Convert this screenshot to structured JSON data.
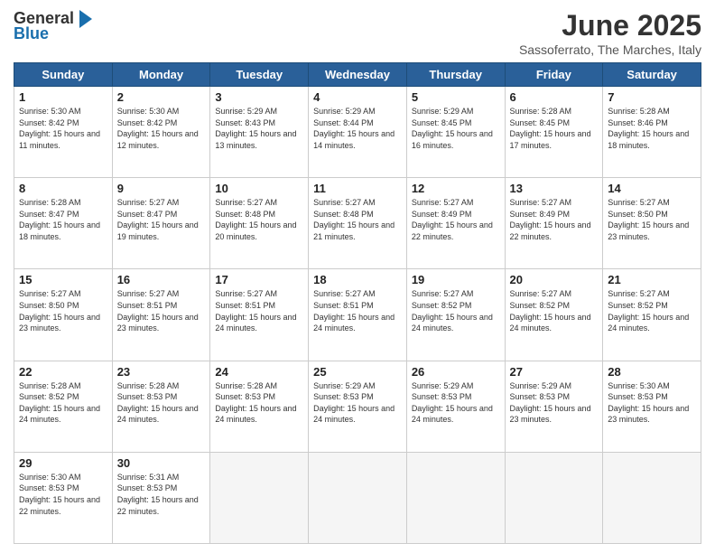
{
  "header": {
    "logo_general": "General",
    "logo_blue": "Blue",
    "month_title": "June 2025",
    "location": "Sassoferrato, The Marches, Italy"
  },
  "days_of_week": [
    "Sunday",
    "Monday",
    "Tuesday",
    "Wednesday",
    "Thursday",
    "Friday",
    "Saturday"
  ],
  "weeks": [
    [
      {
        "day": "1",
        "sunrise": "Sunrise: 5:30 AM",
        "sunset": "Sunset: 8:42 PM",
        "daylight": "Daylight: 15 hours and 11 minutes."
      },
      {
        "day": "2",
        "sunrise": "Sunrise: 5:30 AM",
        "sunset": "Sunset: 8:42 PM",
        "daylight": "Daylight: 15 hours and 12 minutes."
      },
      {
        "day": "3",
        "sunrise": "Sunrise: 5:29 AM",
        "sunset": "Sunset: 8:43 PM",
        "daylight": "Daylight: 15 hours and 13 minutes."
      },
      {
        "day": "4",
        "sunrise": "Sunrise: 5:29 AM",
        "sunset": "Sunset: 8:44 PM",
        "daylight": "Daylight: 15 hours and 14 minutes."
      },
      {
        "day": "5",
        "sunrise": "Sunrise: 5:29 AM",
        "sunset": "Sunset: 8:45 PM",
        "daylight": "Daylight: 15 hours and 16 minutes."
      },
      {
        "day": "6",
        "sunrise": "Sunrise: 5:28 AM",
        "sunset": "Sunset: 8:45 PM",
        "daylight": "Daylight: 15 hours and 17 minutes."
      },
      {
        "day": "7",
        "sunrise": "Sunrise: 5:28 AM",
        "sunset": "Sunset: 8:46 PM",
        "daylight": "Daylight: 15 hours and 18 minutes."
      }
    ],
    [
      {
        "day": "8",
        "sunrise": "Sunrise: 5:28 AM",
        "sunset": "Sunset: 8:47 PM",
        "daylight": "Daylight: 15 hours and 18 minutes."
      },
      {
        "day": "9",
        "sunrise": "Sunrise: 5:27 AM",
        "sunset": "Sunset: 8:47 PM",
        "daylight": "Daylight: 15 hours and 19 minutes."
      },
      {
        "day": "10",
        "sunrise": "Sunrise: 5:27 AM",
        "sunset": "Sunset: 8:48 PM",
        "daylight": "Daylight: 15 hours and 20 minutes."
      },
      {
        "day": "11",
        "sunrise": "Sunrise: 5:27 AM",
        "sunset": "Sunset: 8:48 PM",
        "daylight": "Daylight: 15 hours and 21 minutes."
      },
      {
        "day": "12",
        "sunrise": "Sunrise: 5:27 AM",
        "sunset": "Sunset: 8:49 PM",
        "daylight": "Daylight: 15 hours and 22 minutes."
      },
      {
        "day": "13",
        "sunrise": "Sunrise: 5:27 AM",
        "sunset": "Sunset: 8:49 PM",
        "daylight": "Daylight: 15 hours and 22 minutes."
      },
      {
        "day": "14",
        "sunrise": "Sunrise: 5:27 AM",
        "sunset": "Sunset: 8:50 PM",
        "daylight": "Daylight: 15 hours and 23 minutes."
      }
    ],
    [
      {
        "day": "15",
        "sunrise": "Sunrise: 5:27 AM",
        "sunset": "Sunset: 8:50 PM",
        "daylight": "Daylight: 15 hours and 23 minutes."
      },
      {
        "day": "16",
        "sunrise": "Sunrise: 5:27 AM",
        "sunset": "Sunset: 8:51 PM",
        "daylight": "Daylight: 15 hours and 23 minutes."
      },
      {
        "day": "17",
        "sunrise": "Sunrise: 5:27 AM",
        "sunset": "Sunset: 8:51 PM",
        "daylight": "Daylight: 15 hours and 24 minutes."
      },
      {
        "day": "18",
        "sunrise": "Sunrise: 5:27 AM",
        "sunset": "Sunset: 8:51 PM",
        "daylight": "Daylight: 15 hours and 24 minutes."
      },
      {
        "day": "19",
        "sunrise": "Sunrise: 5:27 AM",
        "sunset": "Sunset: 8:52 PM",
        "daylight": "Daylight: 15 hours and 24 minutes."
      },
      {
        "day": "20",
        "sunrise": "Sunrise: 5:27 AM",
        "sunset": "Sunset: 8:52 PM",
        "daylight": "Daylight: 15 hours and 24 minutes."
      },
      {
        "day": "21",
        "sunrise": "Sunrise: 5:27 AM",
        "sunset": "Sunset: 8:52 PM",
        "daylight": "Daylight: 15 hours and 24 minutes."
      }
    ],
    [
      {
        "day": "22",
        "sunrise": "Sunrise: 5:28 AM",
        "sunset": "Sunset: 8:52 PM",
        "daylight": "Daylight: 15 hours and 24 minutes."
      },
      {
        "day": "23",
        "sunrise": "Sunrise: 5:28 AM",
        "sunset": "Sunset: 8:53 PM",
        "daylight": "Daylight: 15 hours and 24 minutes."
      },
      {
        "day": "24",
        "sunrise": "Sunrise: 5:28 AM",
        "sunset": "Sunset: 8:53 PM",
        "daylight": "Daylight: 15 hours and 24 minutes."
      },
      {
        "day": "25",
        "sunrise": "Sunrise: 5:29 AM",
        "sunset": "Sunset: 8:53 PM",
        "daylight": "Daylight: 15 hours and 24 minutes."
      },
      {
        "day": "26",
        "sunrise": "Sunrise: 5:29 AM",
        "sunset": "Sunset: 8:53 PM",
        "daylight": "Daylight: 15 hours and 24 minutes."
      },
      {
        "day": "27",
        "sunrise": "Sunrise: 5:29 AM",
        "sunset": "Sunset: 8:53 PM",
        "daylight": "Daylight: 15 hours and 23 minutes."
      },
      {
        "day": "28",
        "sunrise": "Sunrise: 5:30 AM",
        "sunset": "Sunset: 8:53 PM",
        "daylight": "Daylight: 15 hours and 23 minutes."
      }
    ],
    [
      {
        "day": "29",
        "sunrise": "Sunrise: 5:30 AM",
        "sunset": "Sunset: 8:53 PM",
        "daylight": "Daylight: 15 hours and 22 minutes."
      },
      {
        "day": "30",
        "sunrise": "Sunrise: 5:31 AM",
        "sunset": "Sunset: 8:53 PM",
        "daylight": "Daylight: 15 hours and 22 minutes."
      },
      null,
      null,
      null,
      null,
      null
    ]
  ]
}
